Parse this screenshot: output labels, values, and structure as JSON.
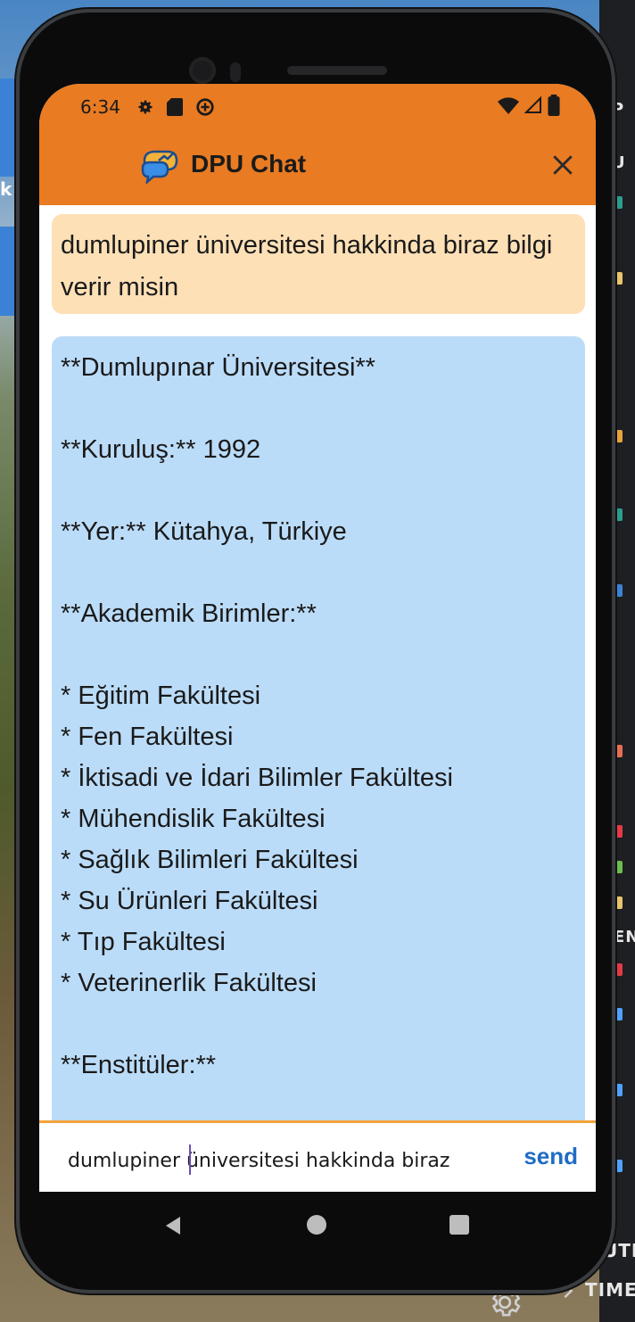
{
  "status_bar": {
    "time": "6:34",
    "left_icons": [
      "settings-icon",
      "sd-card-icon",
      "data-saver-icon"
    ],
    "right_icons": [
      "wifi-icon",
      "signal-icon",
      "battery-icon"
    ]
  },
  "app_bar": {
    "title": "DPU Chat",
    "logo_icon": "chat-bubbles-icon",
    "close_icon": "close-icon"
  },
  "messages": [
    {
      "role": "user",
      "text": "dumlupiner üniversitesi hakkinda biraz bilgi verir misin"
    },
    {
      "role": "bot",
      "lines": [
        "**Dumlupınar Üniversitesi**",
        "",
        "**Kuruluş:** 1992",
        "",
        "**Yer:** Kütahya, Türkiye",
        "",
        "**Akademik Birimler:**",
        "",
        "* Eğitim Fakültesi",
        "* Fen Fakültesi",
        "* İktisadi ve İdari Bilimler Fakültesi",
        "* Mühendislik Fakültesi",
        "* Sağlık Bilimleri Fakültesi",
        "* Su Ürünleri Fakültesi",
        "* Tıp Fakültesi",
        "* Veterinerlik Fakültesi",
        "",
        "**Enstitüler:**"
      ]
    }
  ],
  "composer": {
    "value": "dumlupiner üniversitesi hakkinda biraz",
    "send_label": "send"
  },
  "colors": {
    "app_bar": "#e97b22",
    "user_bubble": "#fde0b6",
    "bot_bubble": "#bbdcf8",
    "send": "#1f6cc4",
    "input_border": "#f2a33a"
  },
  "desktop": {
    "right_labels": [
      "P",
      "U",
      "EN",
      "UTL",
      "TIME"
    ],
    "left_label": "k",
    "gear_icon": "gear-icon"
  }
}
